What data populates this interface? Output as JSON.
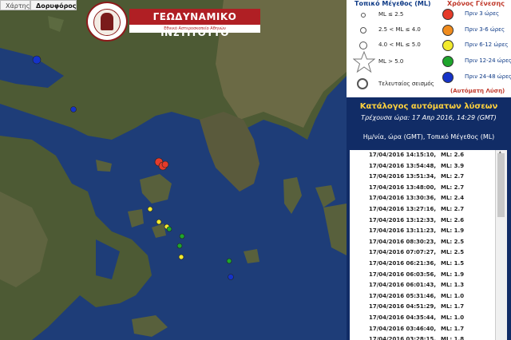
{
  "map": {
    "map_type_buttons": [
      "Χάρτης",
      "Δορυφόρος"
    ],
    "logo": {
      "title": "ΓΕΩΔΥΝΑΜΙΚΟ ΙΝΣΤΙΤΟΥΤΟ",
      "subtitle": "Εθνικό Αστεροσκοπείο Αθηνών"
    },
    "events": [
      {
        "color": "#1533c8"
      },
      {
        "color": "#1533c8"
      },
      {
        "color": "#1533c8"
      },
      {
        "color": "#e53b2a"
      },
      {
        "color": "#e53b2a"
      },
      {
        "color": "#e53b2a"
      },
      {
        "color": "#f2ea2e"
      },
      {
        "color": "#f2ea2e"
      },
      {
        "color": "#f2ea2e"
      },
      {
        "color": "#f2ea2e"
      },
      {
        "color": "#1ea52c"
      },
      {
        "color": "#1ea52c"
      },
      {
        "color": "#1ea52c"
      },
      {
        "color": "#1ea52c"
      }
    ]
  },
  "legend": {
    "size_header": "Τοπικό Μέγεθος (ML)",
    "time_header": "Χρόνος Γένεσης",
    "sizes": [
      {
        "label": "ML ≤ 2.5"
      },
      {
        "label": "2.5 < ML ≤ 4.0"
      },
      {
        "label": "4.0 < ML ≤ 5.0"
      },
      {
        "label": "ML > 5.0"
      },
      {
        "label": "Τελευταίος σεισμός"
      }
    ],
    "times": [
      {
        "label": "Πριν 3 ώρες",
        "color": "#e53b2a"
      },
      {
        "label": "Πριν 3-6 ώρες",
        "color": "#f08c1e"
      },
      {
        "label": "Πριν 6-12 ώρες",
        "color": "#f2ea2e"
      },
      {
        "label": "Πριν 12-24 ώρες",
        "color": "#1ea52c"
      },
      {
        "label": "Πριν 24-48 ώρες",
        "color": "#1533c8"
      }
    ],
    "auto_note": "(Αυτόματη Λύση)"
  },
  "catalog": {
    "title": "Κατάλογος αυτόματων λύσεων",
    "current_time": "Τρέχουσα ώρα: 17 Απρ 2016, 14:29 (GMT)",
    "column_header": "Ημ/νία, ώρα (GMT), Τοπικό Μέγεθος (ML)",
    "rows": [
      {
        "datetime": "17/04/2016 14:15:10,",
        "ml": "ML: 2.6"
      },
      {
        "datetime": "17/04/2016 13:54:48,",
        "ml": "ML: 3.9"
      },
      {
        "datetime": "17/04/2016 13:51:34,",
        "ml": "ML: 2.7"
      },
      {
        "datetime": "17/04/2016 13:48:00,",
        "ml": "ML: 2.7"
      },
      {
        "datetime": "17/04/2016 13:30:36,",
        "ml": "ML: 2.4"
      },
      {
        "datetime": "17/04/2016 13:27:16,",
        "ml": "ML: 2.7"
      },
      {
        "datetime": "17/04/2016 13:12:33,",
        "ml": "ML: 2.6"
      },
      {
        "datetime": "17/04/2016 13:11:23,",
        "ml": "ML: 1.9"
      },
      {
        "datetime": "17/04/2016 08:30:23,",
        "ml": "ML: 2.5"
      },
      {
        "datetime": "17/04/2016 07:07:27,",
        "ml": "ML: 2.5"
      },
      {
        "datetime": "17/04/2016 06:21:36,",
        "ml": "ML: 1.5"
      },
      {
        "datetime": "17/04/2016 06:03:56,",
        "ml": "ML: 1.9"
      },
      {
        "datetime": "17/04/2016 06:01:43,",
        "ml": "ML: 1.3"
      },
      {
        "datetime": "17/04/2016 05:31:46,",
        "ml": "ML: 1.0"
      },
      {
        "datetime": "17/04/2016 04:51:29,",
        "ml": "ML: 1.7"
      },
      {
        "datetime": "17/04/2016 04:35:44,",
        "ml": "ML: 1.0"
      },
      {
        "datetime": "17/04/2016 03:46:40,",
        "ml": "ML: 1.7"
      },
      {
        "datetime": "17/04/2016 03:28:15,",
        "ml": "ML: 1.8"
      }
    ]
  }
}
